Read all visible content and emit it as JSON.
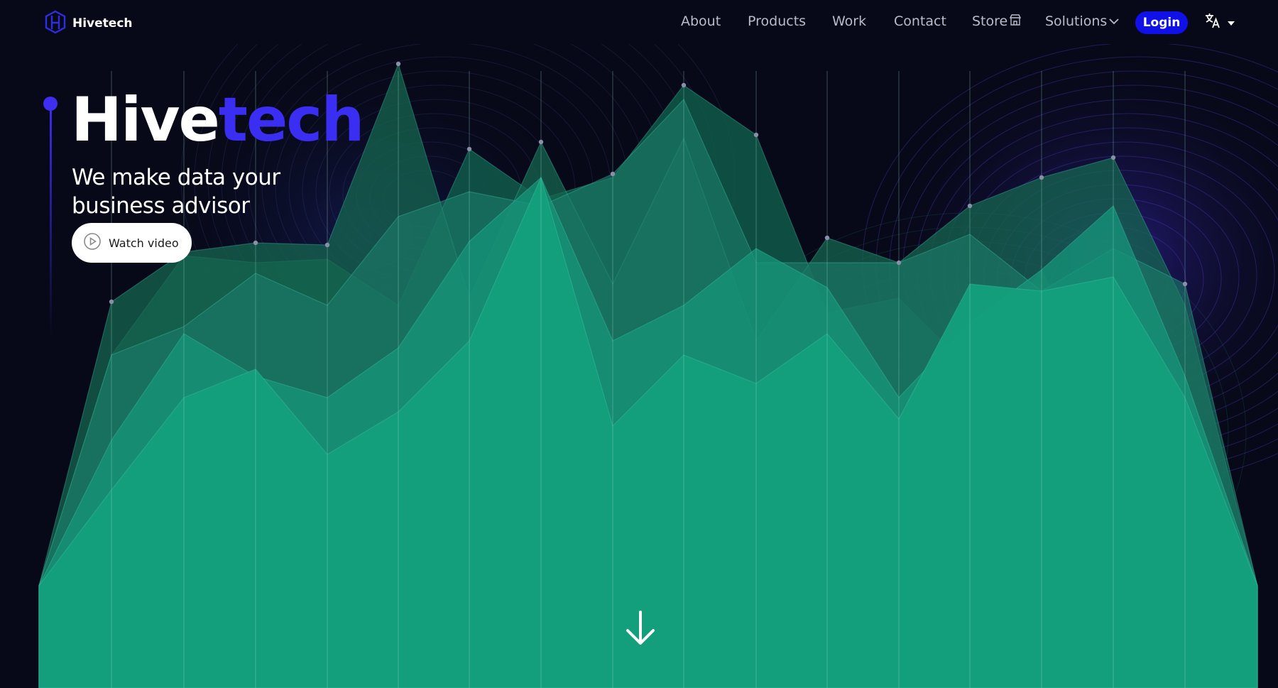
{
  "nav": {
    "brand": "Hivetech",
    "links": [
      "About",
      "Products",
      "Work",
      "Contact",
      "Store",
      "Solutions"
    ],
    "login": "Login",
    "icons": [
      "hivetech-logo-icon",
      "store-icon",
      "chevron-down-icon",
      "translate-icon",
      "caret-down-icon"
    ]
  },
  "hero": {
    "title_part1": "Hive",
    "title_part2": "tech",
    "tagline": "We make data your business advisor",
    "watch_label": "Watch video",
    "icons": [
      "play-circle-icon",
      "arrow-down-icon"
    ]
  },
  "colors": {
    "background": "#070918",
    "accent": "#3a2ef2",
    "login_button": "#1010e8",
    "area_fill": "#14a07c"
  }
}
